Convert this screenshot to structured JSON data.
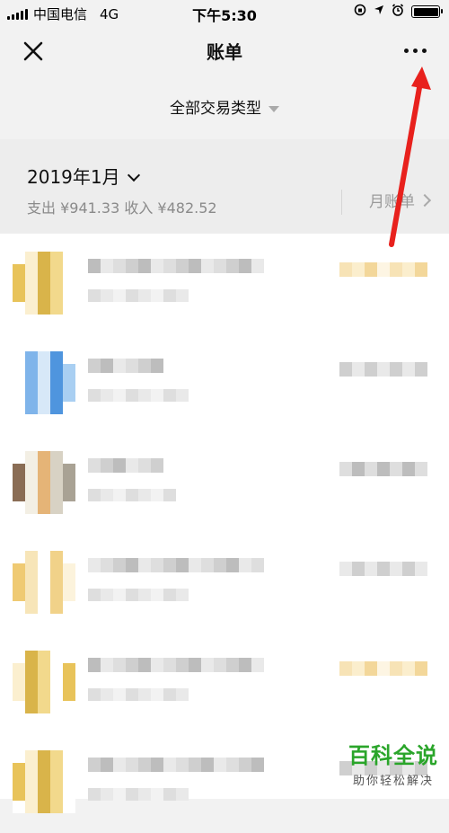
{
  "status_bar": {
    "carrier": "中国电信",
    "network": "4G",
    "time": "下午5:30"
  },
  "nav": {
    "title": "账单"
  },
  "filter": {
    "label": "全部交易类型"
  },
  "month": {
    "label": "2019年1月",
    "summary": "支出 ¥941.33 收入 ¥482.52",
    "month_bill_label": "月账单"
  },
  "watermark": {
    "title": "百科全说",
    "subtitle": "助你轻松解决"
  },
  "colors": {
    "annotation_arrow": "#e8211d",
    "watermark_green": "#2aa52a"
  }
}
